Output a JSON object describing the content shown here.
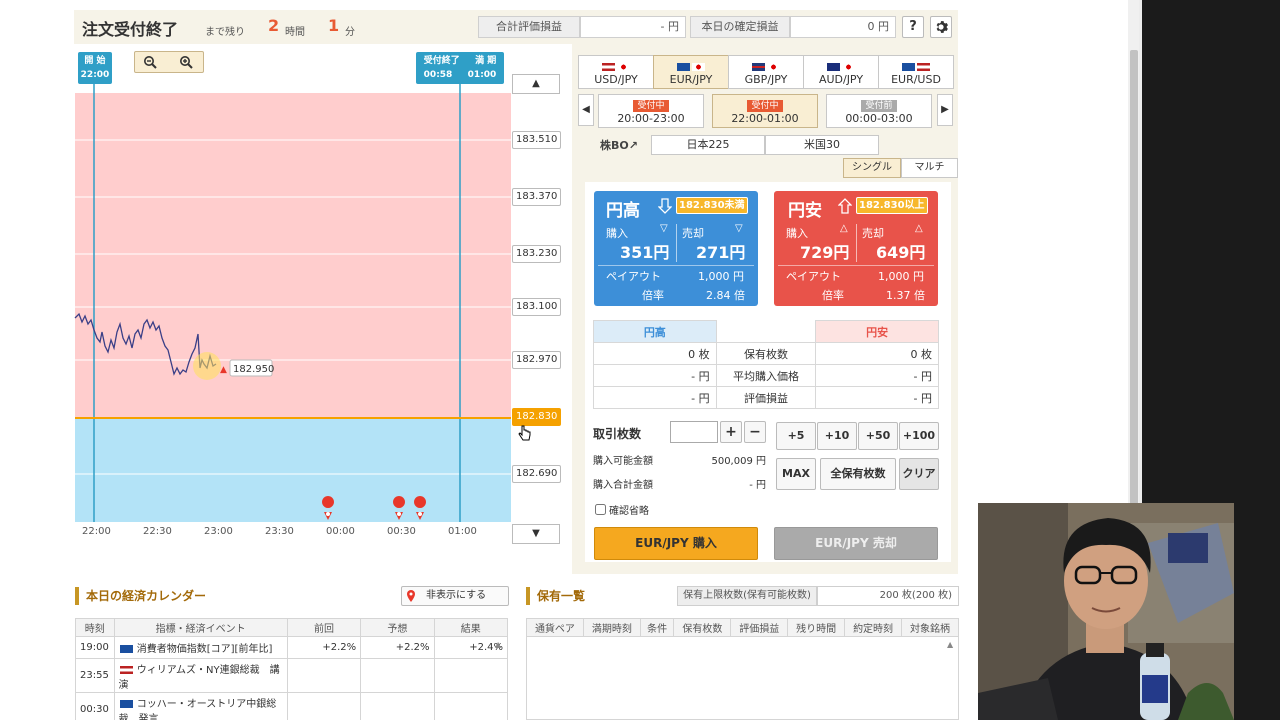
{
  "header": {
    "title": "注文受付終了",
    "until_label": "まで残り",
    "hours_value": "2",
    "hours_unit": "時間",
    "minutes_value": "1",
    "minutes_unit": "分",
    "eval_label": "合計評価損益",
    "eval_value": "- 円",
    "fixed_label": "本日の確定損益",
    "fixed_value": "0 円",
    "help_label": "?",
    "settings_icon": "gear-icon"
  },
  "chart": {
    "start_marker": {
      "label": "開 始",
      "time": "22:00"
    },
    "end_marker": {
      "label1": "受付終了",
      "label2": "満 期",
      "time1": "00:58",
      "time2": "01:00"
    },
    "zoom_out_icon": "zoom-out-icon",
    "zoom_in_icon": "zoom-in-icon",
    "scale_labels": [
      "183.510",
      "183.370",
      "183.230",
      "183.100",
      "182.970",
      "182.830",
      "182.690"
    ],
    "up_arrow": "▲",
    "down_arrow": "▼",
    "current_price": "182.950",
    "target_price": "182.830",
    "x_ticks": [
      "22:00",
      "22:30",
      "23:00",
      "23:30",
      "00:00",
      "00:30",
      "01:00"
    ],
    "upper_color": "#ffcdcd",
    "lower_color": "#b3e3f7",
    "line_color": "#3a3f87",
    "target_color": "#f5a100"
  },
  "pairs": {
    "tabs": [
      "USD/JPY",
      "EUR/JPY",
      "GBP/JPY",
      "AUD/JPY",
      "EUR/USD"
    ],
    "active_index": 1
  },
  "sessions": [
    {
      "status": "受付中",
      "range": "20:00-23:00"
    },
    {
      "status": "受付中",
      "range": "22:00-01:00"
    },
    {
      "status": "受付前",
      "range": "00:00-03:00"
    }
  ],
  "stock_bo": {
    "label": "株BO",
    "items": [
      "日本225",
      "米国30"
    ]
  },
  "mode": {
    "single": "シングル",
    "multi": "マルチ"
  },
  "cards": {
    "high": {
      "title": "円高",
      "condition": "182.830未満",
      "buy_label": "購入",
      "buy_price": "351円",
      "sell_label": "売却",
      "sell_price": "271円",
      "payout_label": "ペイアウト",
      "payout_value": "1,000 円",
      "ratio_label": "倍率",
      "ratio_value": "2.84 倍",
      "color": "#3d8fd8"
    },
    "low": {
      "title": "円安",
      "condition": "182.830以上",
      "buy_label": "購入",
      "buy_price": "729円",
      "sell_label": "売却",
      "sell_price": "649円",
      "payout_label": "ペイアウト",
      "payout_value": "1,000 円",
      "ratio_label": "倍率",
      "ratio_value": "1.37 倍",
      "color": "#e8534a"
    }
  },
  "positions": {
    "head_high": "円高",
    "head_low": "円安",
    "rows": [
      {
        "left": "0 枚",
        "label": "保有枚数",
        "right": "0 枚"
      },
      {
        "left": "- 円",
        "label": "平均購入価格",
        "right": "- 円"
      },
      {
        "left": "- 円",
        "label": "評価損益",
        "right": "- 円"
      }
    ]
  },
  "order": {
    "qty_label": "取引枚数",
    "qty_value": "",
    "plus": "+",
    "minus": "−",
    "avail_label": "購入可能金額",
    "avail_value": "500,009 円",
    "total_label": "購入合計金額",
    "total_value": "- 円",
    "quick": [
      "+5",
      "+10",
      "+50",
      "+100"
    ],
    "max": "MAX",
    "all": "全保有枚数",
    "clear": "クリア",
    "confirm_skip": "確認省略",
    "buy": "EUR/JPY 購入",
    "sell": "EUR/JPY 売却"
  },
  "calendar": {
    "title": "本日の経済カレンダー",
    "hide_button": "非表示にする",
    "headers": [
      "時刻",
      "指標・経済イベント",
      "前回",
      "予想",
      "結果"
    ],
    "rows": [
      {
        "time": "19:00",
        "event": "消費者物価指数[コア][前年比]",
        "prev": "+2.2%",
        "fcst": "+2.2%",
        "result": "+2.4%"
      },
      {
        "time": "23:55",
        "event": "ウィリアムズ・NY連銀総裁　講演",
        "prev": "",
        "fcst": "",
        "result": ""
      },
      {
        "time": "00:30",
        "event": "コッハー・オーストリア中銀総裁　発言",
        "prev": "",
        "fcst": "",
        "result": ""
      }
    ]
  },
  "holdings": {
    "title": "保有一覧",
    "limit_label": "保有上限枚数(保有可能枚数)",
    "limit_value": "200 枚(200 枚)",
    "headers": [
      "通貨ペア",
      "満期時刻",
      "条件",
      "保有枚数",
      "評価損益",
      "残り時間",
      "約定時刻",
      "対象銘柄"
    ]
  }
}
